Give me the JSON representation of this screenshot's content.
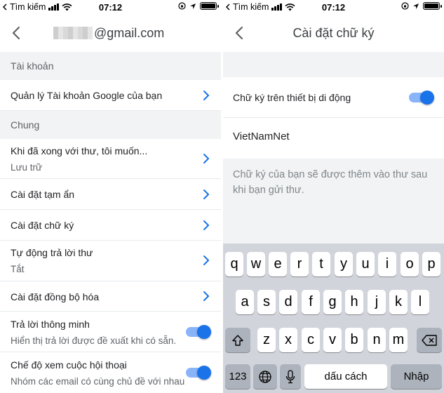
{
  "left": {
    "status": {
      "carrier": "Tìm kiếm",
      "time": "07:12"
    },
    "header": {
      "email_suffix": "@gmail.com"
    },
    "sections": [
      {
        "header": "Tài khoản"
      },
      {
        "header": "Chung"
      }
    ],
    "items": [
      {
        "primary": "Quản lý Tài khoản Google của bạn"
      },
      {
        "primary": "Khi đã xong với thư, tôi muốn...",
        "secondary": "Lưu trữ"
      },
      {
        "primary": "Cài đặt tạm ẩn"
      },
      {
        "primary": "Cài đặt chữ ký"
      },
      {
        "primary": "Tự động trả lời thư",
        "secondary": "Tắt"
      },
      {
        "primary": "Cài đặt đồng bộ hóa"
      },
      {
        "primary": "Trả lời thông minh",
        "secondary": "Hiển thị trả lời được đề xuất khi có sẵn.",
        "toggle_on": true
      },
      {
        "primary": "Chế độ xem cuộc hội thoại",
        "secondary": "Nhóm các email có cùng chủ đề với nhau",
        "toggle_on": true
      }
    ]
  },
  "right": {
    "status": {
      "carrier": "Tìm kiếm",
      "time": "07:12"
    },
    "header": {
      "title": "Cài đặt chữ ký"
    },
    "mobile_signature": {
      "label": "Chữ ký trên thiết bị di động",
      "toggle_on": true
    },
    "signature_value": "VietNamNet",
    "hint": "Chữ ký của bạn sẽ được thêm vào thư sau khi bạn gửi thư.",
    "keyboard": {
      "row1": [
        "q",
        "w",
        "e",
        "r",
        "t",
        "y",
        "u",
        "i",
        "o",
        "p"
      ],
      "row2": [
        "a",
        "s",
        "d",
        "f",
        "g",
        "h",
        "j",
        "k",
        "l"
      ],
      "row3": [
        "z",
        "x",
        "c",
        "v",
        "b",
        "n",
        "m"
      ],
      "numbers_key": "123",
      "space_key": "dấu cách",
      "return_key": "Nhập"
    }
  },
  "colors": {
    "accent": "#1a73e8",
    "section_bg": "#f1f3f4",
    "keyboard_bg": "#d1d4db"
  }
}
